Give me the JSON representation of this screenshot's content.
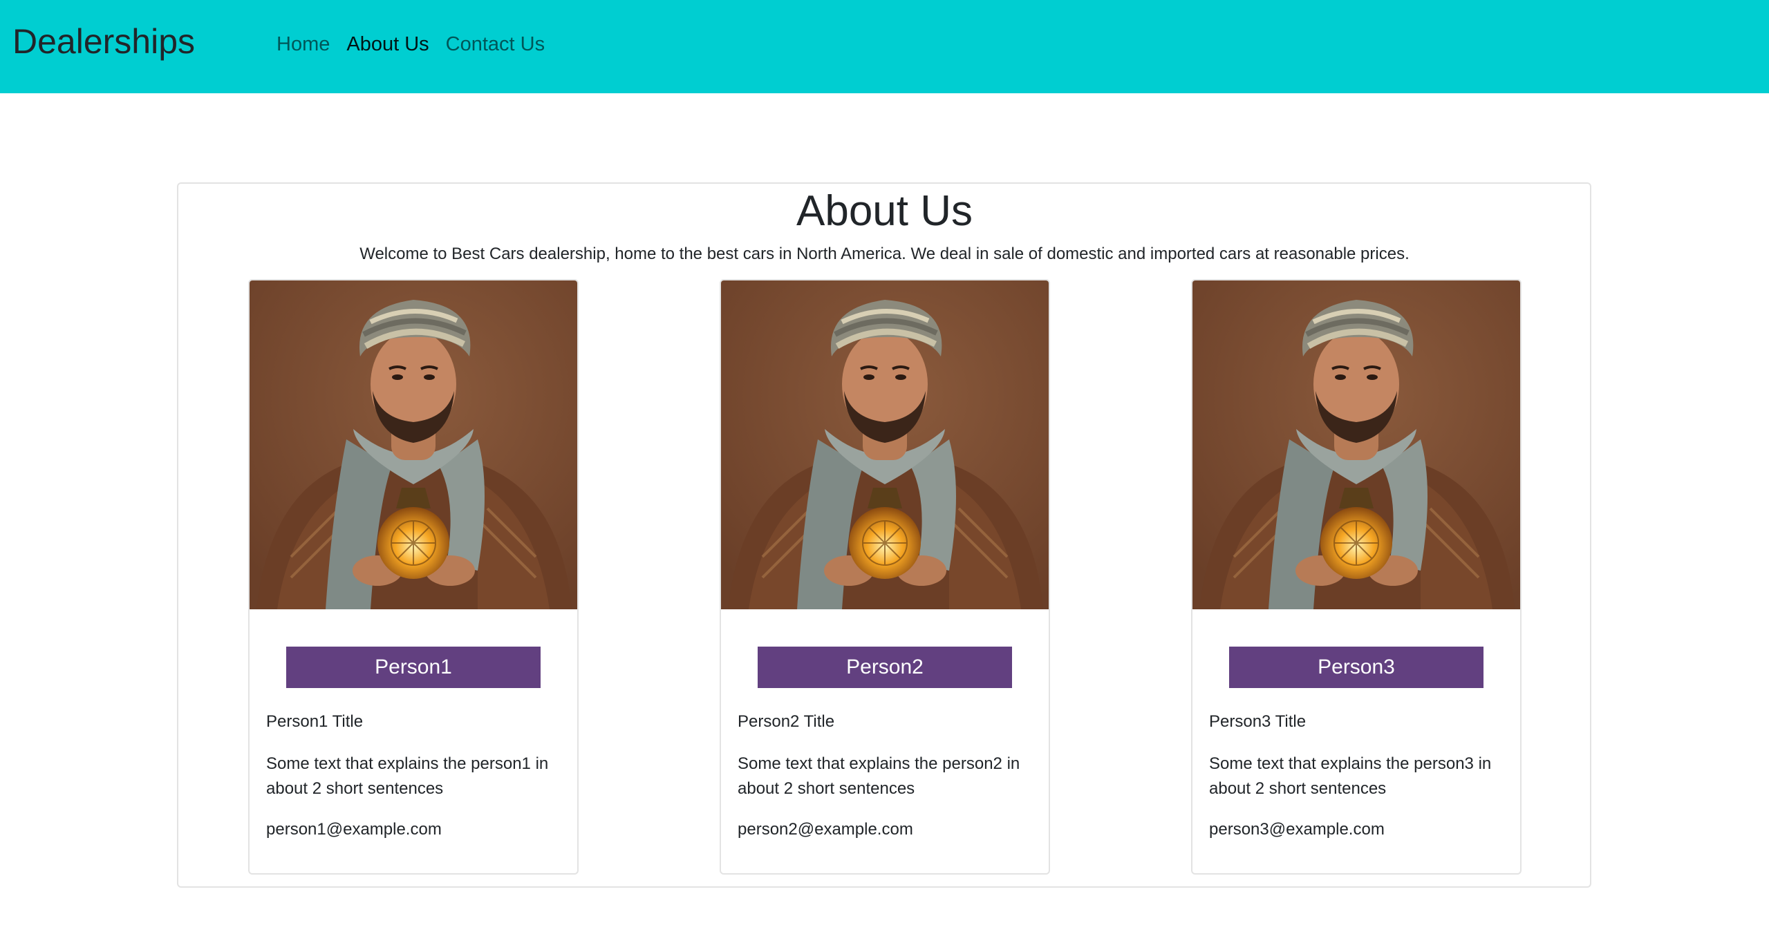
{
  "navbar": {
    "brand": "Dealerships",
    "links": [
      {
        "label": "Home",
        "active": false
      },
      {
        "label": "About Us",
        "active": true
      },
      {
        "label": "Contact Us",
        "active": false
      }
    ],
    "background": "#00ced1"
  },
  "about": {
    "title": "About Us",
    "intro": "Welcome to Best Cars dealership, home to the best cars in North America. We deal in sale of domestic and imported cars at reasonable prices."
  },
  "people": [
    {
      "name": "Person1",
      "title": "Person1 Title",
      "description": "Some text that explains the person1 in about 2 short sentences",
      "email": "person1@example.com"
    },
    {
      "name": "Person2",
      "title": "Person2 Title",
      "description": "Some text that explains the person2 in about 2 short sentences",
      "email": "person2@example.com"
    },
    {
      "name": "Person3",
      "title": "Person3 Title",
      "description": "Some text that explains the person3 in about 2 short sentences",
      "email": "person3@example.com"
    }
  ],
  "colors": {
    "accent": "#624080",
    "nav_bg": "#00ced1"
  }
}
